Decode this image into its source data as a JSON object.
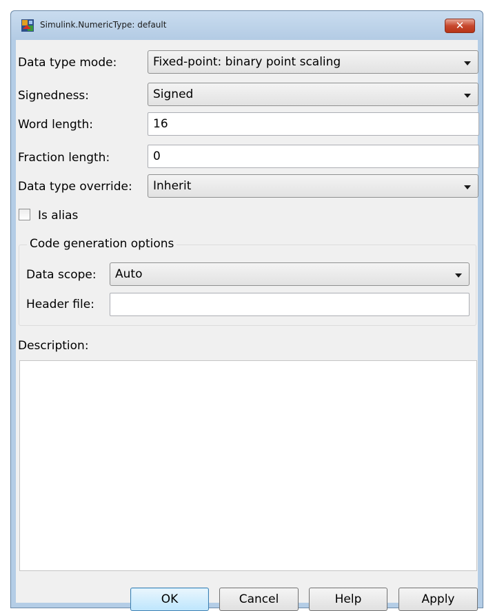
{
  "window": {
    "title": "Simulink.NumericType: default",
    "close_label": "✕"
  },
  "form": {
    "data_type_mode": {
      "label": "Data type mode:",
      "value": "Fixed-point: binary point scaling"
    },
    "signedness": {
      "label": "Signedness:",
      "value": "Signed"
    },
    "word_length": {
      "label": "Word length:",
      "value": "16"
    },
    "fraction_length": {
      "label": "Fraction length:",
      "value": "0"
    },
    "data_type_override": {
      "label": "Data type override:",
      "value": "Inherit"
    },
    "is_alias": {
      "label": "Is alias",
      "checked": false
    }
  },
  "code_generation": {
    "title": "Code generation options",
    "data_scope": {
      "label": "Data scope:",
      "value": "Auto"
    },
    "header_file": {
      "label": "Header file:",
      "value": ""
    }
  },
  "description": {
    "label": "Description:",
    "value": ""
  },
  "buttons": {
    "ok": "OK",
    "cancel": "Cancel",
    "help": "Help",
    "apply": "Apply"
  },
  "colors": {
    "window_frame": "#b4cde6",
    "dialog_bg": "#f0f0f0",
    "close_button": "#c7482e",
    "default_button_border": "#3c7fb1"
  }
}
